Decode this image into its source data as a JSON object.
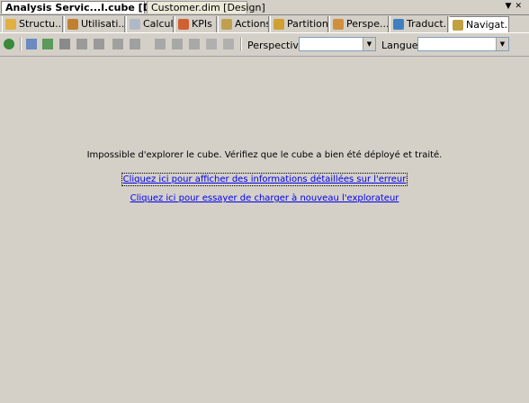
{
  "document_tabs": {
    "active": "Analysis Servic...l.cube [Design]",
    "inactive": "Customer.dim [Design]"
  },
  "designer_tabs": [
    {
      "label": "Structu...",
      "icon": "structure-icon",
      "color": "#e0b040"
    },
    {
      "label": "Utilisati...",
      "icon": "usage-icon",
      "color": "#c08030"
    },
    {
      "label": "Calculs",
      "icon": "calculations-icon",
      "color": "#b0b8c8"
    },
    {
      "label": "KPIs",
      "icon": "kpi-icon",
      "color": "#d06030"
    },
    {
      "label": "Actions",
      "icon": "actions-icon",
      "color": "#c0a050"
    },
    {
      "label": "Partitions",
      "icon": "partitions-icon",
      "color": "#d0a030"
    },
    {
      "label": "Perspe...",
      "icon": "perspectives-icon",
      "color": "#d09040"
    },
    {
      "label": "Traduct...",
      "icon": "translations-icon",
      "color": "#4080c0"
    },
    {
      "label": "Navigat...",
      "icon": "browser-icon",
      "color": "#c0a040"
    }
  ],
  "toolbar": {
    "perspective_label": "Perspective :",
    "perspective_value": "",
    "language_label": "Langue :",
    "language_value": ""
  },
  "content": {
    "error_message": "Impossible d'explorer le cube. Vérifiez que le cube a bien été déployé et traité.",
    "details_link": "Cliquez ici pour afficher des informations détaillées sur l'erreur",
    "reload_link": "Cliquez ici pour essayer de charger à nouveau l'explorateur"
  }
}
